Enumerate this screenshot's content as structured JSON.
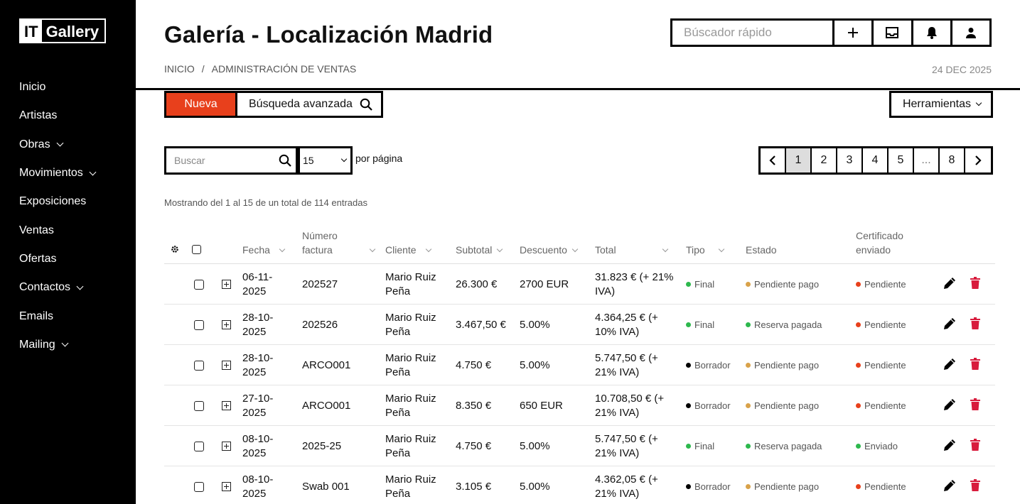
{
  "sidebar": {
    "logo_it": "IT",
    "logo_gallery": "Gallery",
    "items": [
      {
        "label": "Inicio",
        "has_submenu": false
      },
      {
        "label": "Artistas",
        "has_submenu": false
      },
      {
        "label": "Obras",
        "has_submenu": true
      },
      {
        "label": "Movimientos",
        "has_submenu": true
      },
      {
        "label": "Exposiciones",
        "has_submenu": false
      },
      {
        "label": "Ventas",
        "has_submenu": false
      },
      {
        "label": "Ofertas",
        "has_submenu": false
      },
      {
        "label": "Contactos",
        "has_submenu": true
      },
      {
        "label": "Emails",
        "has_submenu": false
      },
      {
        "label": "Mailing",
        "has_submenu": true
      }
    ]
  },
  "header": {
    "title": "Galería - Localización Madrid",
    "breadcrumb": [
      "INICIO",
      "/",
      "ADMINISTRACIÓN DE VENTAS"
    ],
    "date": "24 DEC 2025",
    "quick_search_placeholder": "Búscador rápido",
    "icons": [
      "plus-icon",
      "inbox-icon",
      "bell-icon",
      "user-icon"
    ]
  },
  "toolbar": {
    "new_label": "Nueva",
    "advanced_label": "Búsqueda avanzada",
    "tools_label": "Herramientas"
  },
  "filters": {
    "search_placeholder": "Buscar",
    "per_page_value": "15",
    "per_page_label": "por página"
  },
  "pagination": {
    "pages": [
      "1",
      "2",
      "3",
      "4",
      "5",
      "...",
      "8"
    ],
    "current": "1"
  },
  "showing_text": "Mostrando del 1 al 15 de un total de 114 entradas",
  "table": {
    "headers": {
      "fecha": "Fecha",
      "numero_1": "Número",
      "numero_2": "factura",
      "cliente": "Cliente",
      "subtotal": "Subtotal",
      "descuento": "Descuento",
      "total": "Total",
      "tipo": "Tipo",
      "estado": "Estado",
      "cert_1": "Certificado",
      "cert_2": "enviado"
    },
    "rows": [
      {
        "fecha1": "06-11-",
        "fecha2": "2025",
        "numero": "202527",
        "cliente1": "Mario Ruiz",
        "cliente2": "Peña",
        "subtotal": "26.300 €",
        "descuento": "2700 EUR",
        "total1": "31.823 € (+ 21%",
        "total2": "IVA)",
        "tipo": "Final",
        "tipo_color": "#2db84d",
        "estado": "Pendiente pago",
        "estado_color": "#d9a24a",
        "cert": "Pendiente",
        "cert_color": "#e8401c"
      },
      {
        "fecha1": "28-10-",
        "fecha2": "2025",
        "numero": "202526",
        "cliente1": "Mario Ruiz",
        "cliente2": "Peña",
        "subtotal": "3.467,50 €",
        "descuento": "5.00%",
        "total1": "4.364,25 € (+",
        "total2": "10% IVA)",
        "tipo": "Final",
        "tipo_color": "#2db84d",
        "estado": "Reserva pagada",
        "estado_color": "#2db84d",
        "cert": "Pendiente",
        "cert_color": "#e8401c"
      },
      {
        "fecha1": "28-10-",
        "fecha2": "2025",
        "numero": "ARCO001",
        "cliente1": "Mario Ruiz",
        "cliente2": "Peña",
        "subtotal": "4.750 €",
        "descuento": "5.00%",
        "total1": "5.747,50 € (+",
        "total2": "21% IVA)",
        "tipo": "Borrador",
        "tipo_color": "#000000",
        "estado": "Pendiente pago",
        "estado_color": "#d9a24a",
        "cert": "Pendiente",
        "cert_color": "#e8401c"
      },
      {
        "fecha1": "27-10-",
        "fecha2": "2025",
        "numero": "ARCO001",
        "cliente1": "Mario Ruiz",
        "cliente2": "Peña",
        "subtotal": "8.350 €",
        "descuento": "650 EUR",
        "total1": "10.708,50 € (+",
        "total2": "21% IVA)",
        "tipo": "Borrador",
        "tipo_color": "#000000",
        "estado": "Pendiente pago",
        "estado_color": "#d9a24a",
        "cert": "Pendiente",
        "cert_color": "#e8401c"
      },
      {
        "fecha1": "08-10-",
        "fecha2": "2025",
        "numero": "2025-25",
        "cliente1": "Mario Ruiz",
        "cliente2": "Peña",
        "subtotal": "4.750 €",
        "descuento": "5.00%",
        "total1": "5.747,50 € (+",
        "total2": "21% IVA)",
        "tipo": "Final",
        "tipo_color": "#2db84d",
        "estado": "Reserva pagada",
        "estado_color": "#2db84d",
        "cert": "Enviado",
        "cert_color": "#2db84d"
      },
      {
        "fecha1": "08-10-",
        "fecha2": "2025",
        "numero": "Swab 001",
        "cliente1": "Mario Ruiz",
        "cliente2": "Peña",
        "subtotal": "3.105 €",
        "descuento": "5.00%",
        "total1": "4.362,05 € (+",
        "total2": "21% IVA)",
        "tipo": "Borrador",
        "tipo_color": "#000000",
        "estado": "Pendiente pago",
        "estado_color": "#d9a24a",
        "cert": "Pendiente",
        "cert_color": "#e8401c"
      }
    ]
  }
}
